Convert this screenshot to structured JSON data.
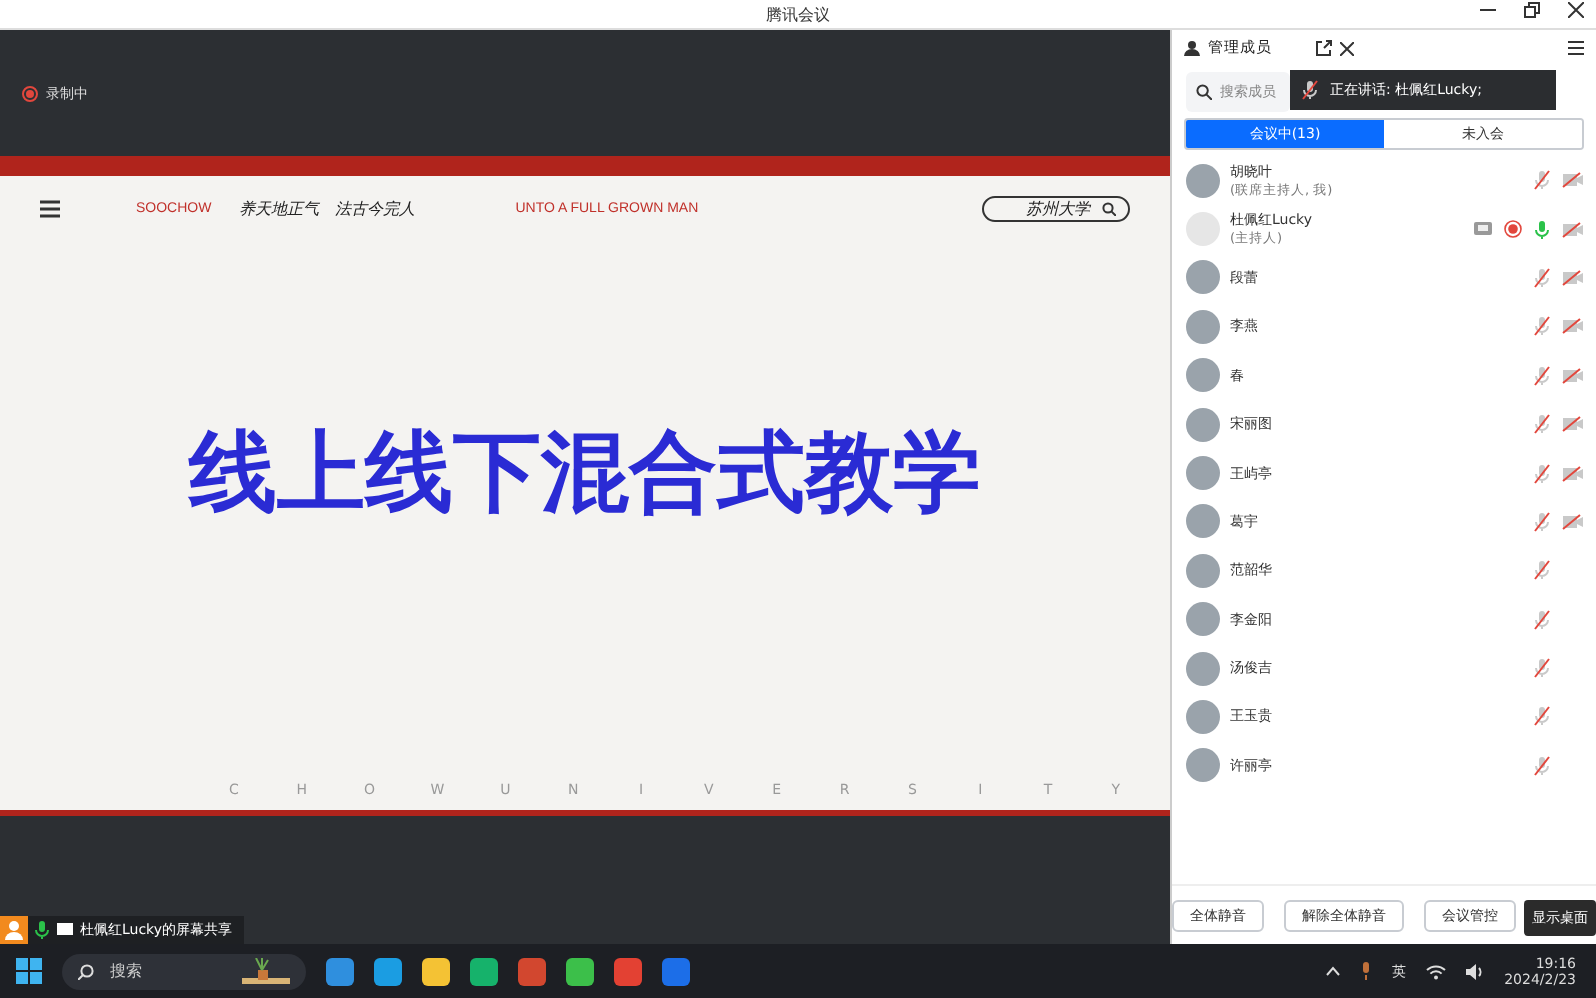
{
  "window": {
    "title": "腾讯会议"
  },
  "recording": {
    "label": "录制中"
  },
  "slide": {
    "nav_brand": "SOOCHOW",
    "motto_left": "养天地正气",
    "motto_right": "法古今完人",
    "nav_slogan": "UNTO A FULL GROWN MAN",
    "search_logo": "苏州大学",
    "title": "线上线下混合式教学",
    "footer_letters": [
      "C",
      "H",
      "O",
      "W",
      "U",
      "N",
      "I",
      "V",
      "E",
      "R",
      "S",
      "I",
      "T",
      "Y"
    ]
  },
  "share_label": {
    "text": "杜佩红Lucky的屏幕共享"
  },
  "panel": {
    "title": "管理成员",
    "search_placeholder": "搜索成员",
    "speaking": {
      "prefix": "正在讲话:",
      "name": "杜佩红Lucky;"
    },
    "tabs": [
      {
        "label": "会议中(13)",
        "selected": true
      },
      {
        "label": "未入会",
        "selected": false
      }
    ],
    "members": [
      {
        "name": "胡晓叶",
        "role": "(联席主持人, 我)",
        "muted": true,
        "has_video": true,
        "sharing": false,
        "recording": false
      },
      {
        "name": "杜佩红Lucky",
        "role": "(主持人)",
        "muted": false,
        "has_video": true,
        "sharing": true,
        "recording": true
      },
      {
        "name": "段蕾",
        "muted": true,
        "has_video": true,
        "sharing": false,
        "recording": false
      },
      {
        "name": "李燕",
        "muted": true,
        "has_video": true,
        "sharing": false,
        "recording": false
      },
      {
        "name": "春",
        "muted": true,
        "has_video": true,
        "sharing": false,
        "recording": false
      },
      {
        "name": "宋丽图",
        "muted": true,
        "has_video": true,
        "sharing": false,
        "recording": false
      },
      {
        "name": "王屿亭",
        "muted": true,
        "has_video": true,
        "sharing": false,
        "recording": false
      },
      {
        "name": "葛宇",
        "muted": true,
        "has_video": true,
        "sharing": false,
        "recording": false
      },
      {
        "name": "范韶华",
        "muted": true,
        "has_video": false,
        "sharing": false,
        "recording": false
      },
      {
        "name": "李金阳",
        "muted": true,
        "has_video": false,
        "sharing": false,
        "recording": false
      },
      {
        "name": "汤俊吉",
        "muted": true,
        "has_video": false,
        "sharing": false,
        "recording": false
      },
      {
        "name": "王玉贵",
        "muted": true,
        "has_video": false,
        "sharing": false,
        "recording": false
      },
      {
        "name": "许丽亭",
        "muted": true,
        "has_video": false,
        "sharing": false,
        "recording": false
      }
    ],
    "buttons": [
      "全体静音",
      "解除全体静音",
      "会议管控"
    ],
    "tooltip": "显示桌面"
  },
  "taskbar": {
    "search_placeholder": "搜索",
    "ime": "英",
    "time": "19:16",
    "date": "2024/2/23"
  }
}
